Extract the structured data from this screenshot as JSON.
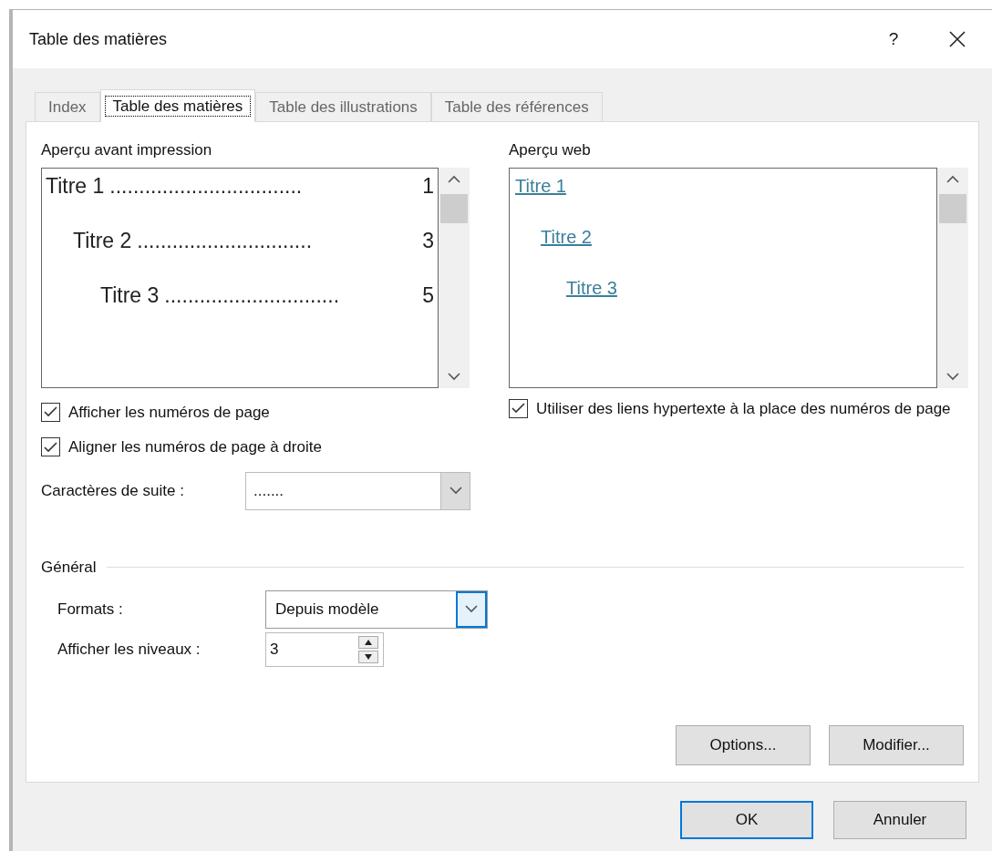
{
  "window": {
    "title": "Table des matières",
    "help": "?"
  },
  "tabs": [
    {
      "label": "Index",
      "selected": false
    },
    {
      "label": "Table des matières",
      "selected": true
    },
    {
      "label": "Table des illustrations",
      "selected": false
    },
    {
      "label": "Table des références",
      "selected": false
    }
  ],
  "print_preview": {
    "label": "Aperçu avant impression",
    "entries": [
      {
        "title": "Titre 1",
        "leader": ".................................",
        "page": "1",
        "children": [
          {
            "title": "Titre 2",
            "leader": "..............................",
            "page": "3",
            "children": [
              {
                "title": "Titre 3",
                "leader": "..............................",
                "page": "5"
              }
            ]
          }
        ]
      }
    ]
  },
  "web_preview": {
    "label": "Aperçu web",
    "entries": [
      {
        "title": "Titre 1",
        "children": [
          {
            "title": "Titre 2",
            "children": [
              {
                "title": "Titre 3"
              }
            ]
          }
        ]
      }
    ]
  },
  "left_options": [
    {
      "label": "Afficher les numéros de page",
      "checked": true
    },
    {
      "label": "Aligner les numéros de page à droite",
      "checked": true
    }
  ],
  "leader_chars": {
    "label": "Caractères de suite :",
    "value": "......."
  },
  "right_options": [
    {
      "label": "Utiliser des liens hypertexte à la place des numéros de page",
      "checked": true
    }
  ],
  "general": {
    "label": "Général",
    "formats": {
      "label": "Formats :",
      "value": "Depuis modèle"
    },
    "levels": {
      "label": "Afficher les niveaux :",
      "value": "3"
    }
  },
  "panel_buttons": [
    "Options...",
    "Modifier..."
  ],
  "dialog_buttons": [
    {
      "label": "OK",
      "default": true
    },
    {
      "label": "Annuler",
      "default": false
    }
  ]
}
